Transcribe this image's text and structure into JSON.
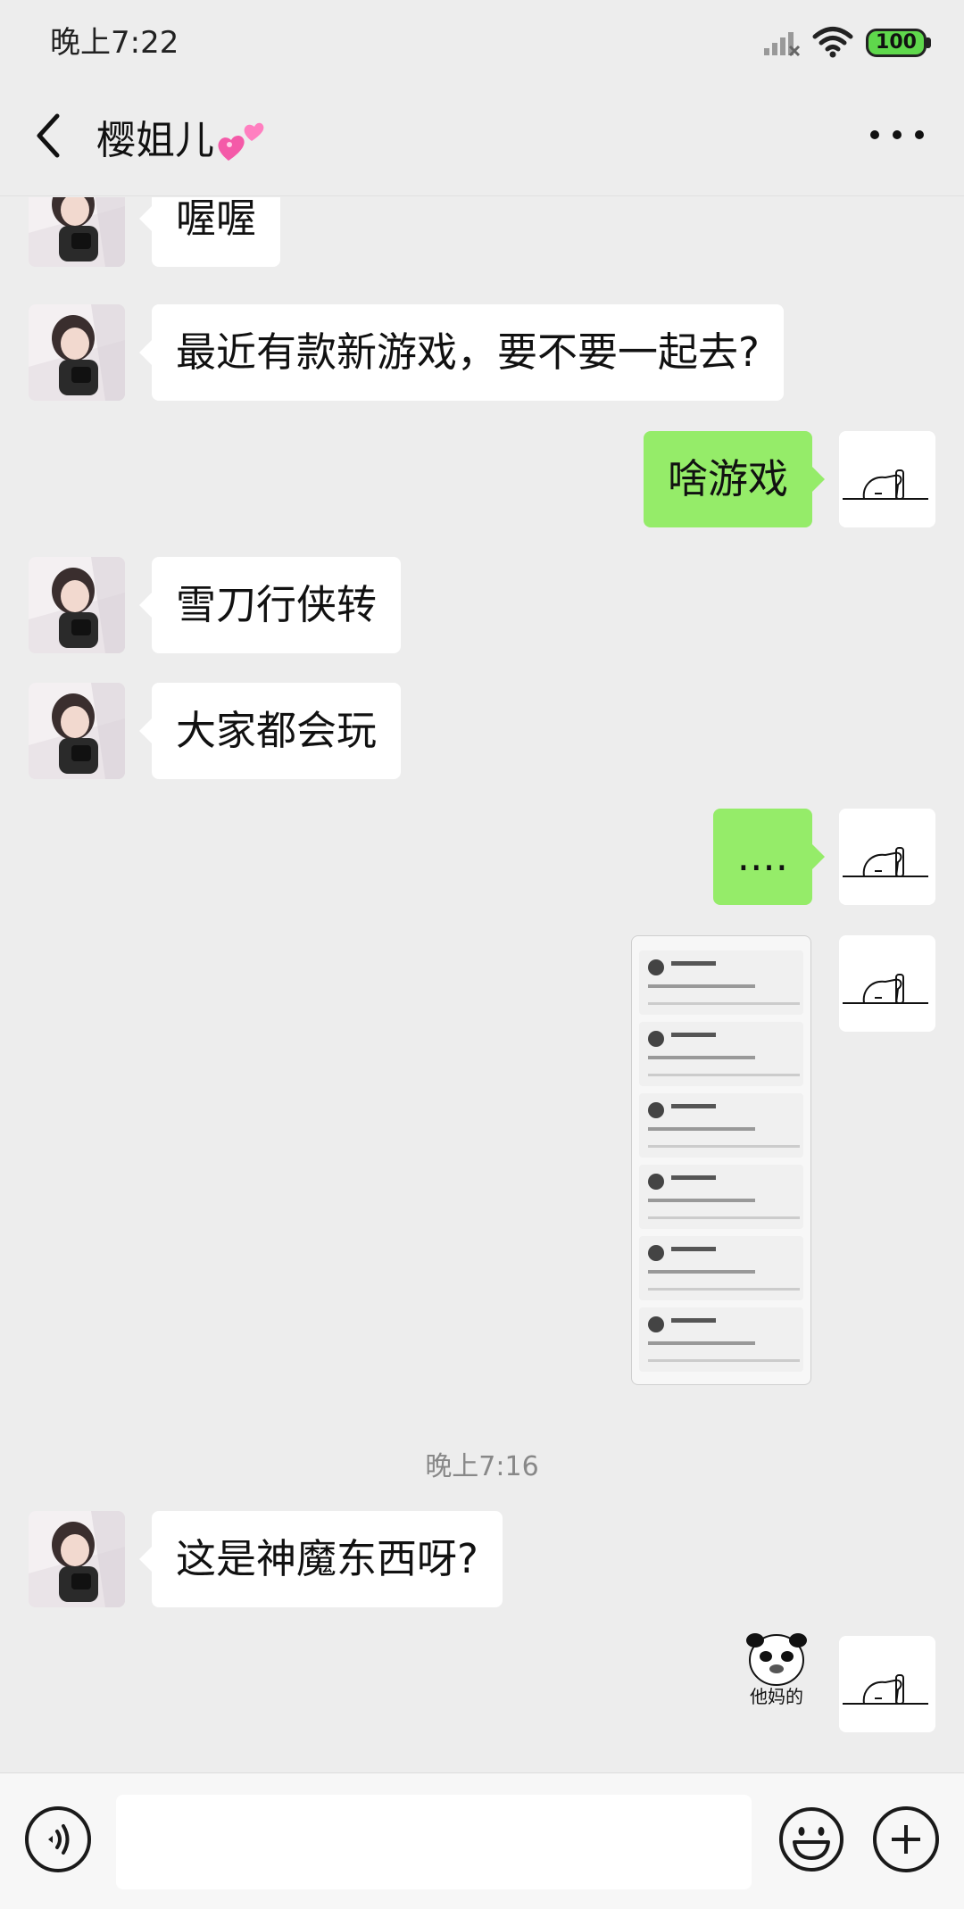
{
  "status_bar": {
    "time": "晚上7:22",
    "battery": "100"
  },
  "header": {
    "title": "樱姐儿",
    "title_emoji": "heart-icon"
  },
  "messages": [
    {
      "side": "in",
      "text": "喔喔"
    },
    {
      "side": "in",
      "text": "最近有款新游戏，要不要一起去?"
    },
    {
      "side": "out",
      "text": "啥游戏"
    },
    {
      "side": "in",
      "text": "雪刀行侠转"
    },
    {
      "side": "in",
      "text": "大家都会玩"
    },
    {
      "side": "out",
      "text": "...."
    },
    {
      "side": "out",
      "type": "image",
      "text": ""
    },
    {
      "type": "timestamp",
      "text": "晚上7:16"
    },
    {
      "side": "in",
      "text": "这是神魔东西呀?"
    },
    {
      "side": "out",
      "type": "sticker",
      "text": "他妈的"
    }
  ],
  "input": {
    "placeholder": ""
  },
  "colors": {
    "outgoing_bubble": "#95ec69",
    "incoming_bubble": "#ffffff",
    "background": "#ededed"
  }
}
